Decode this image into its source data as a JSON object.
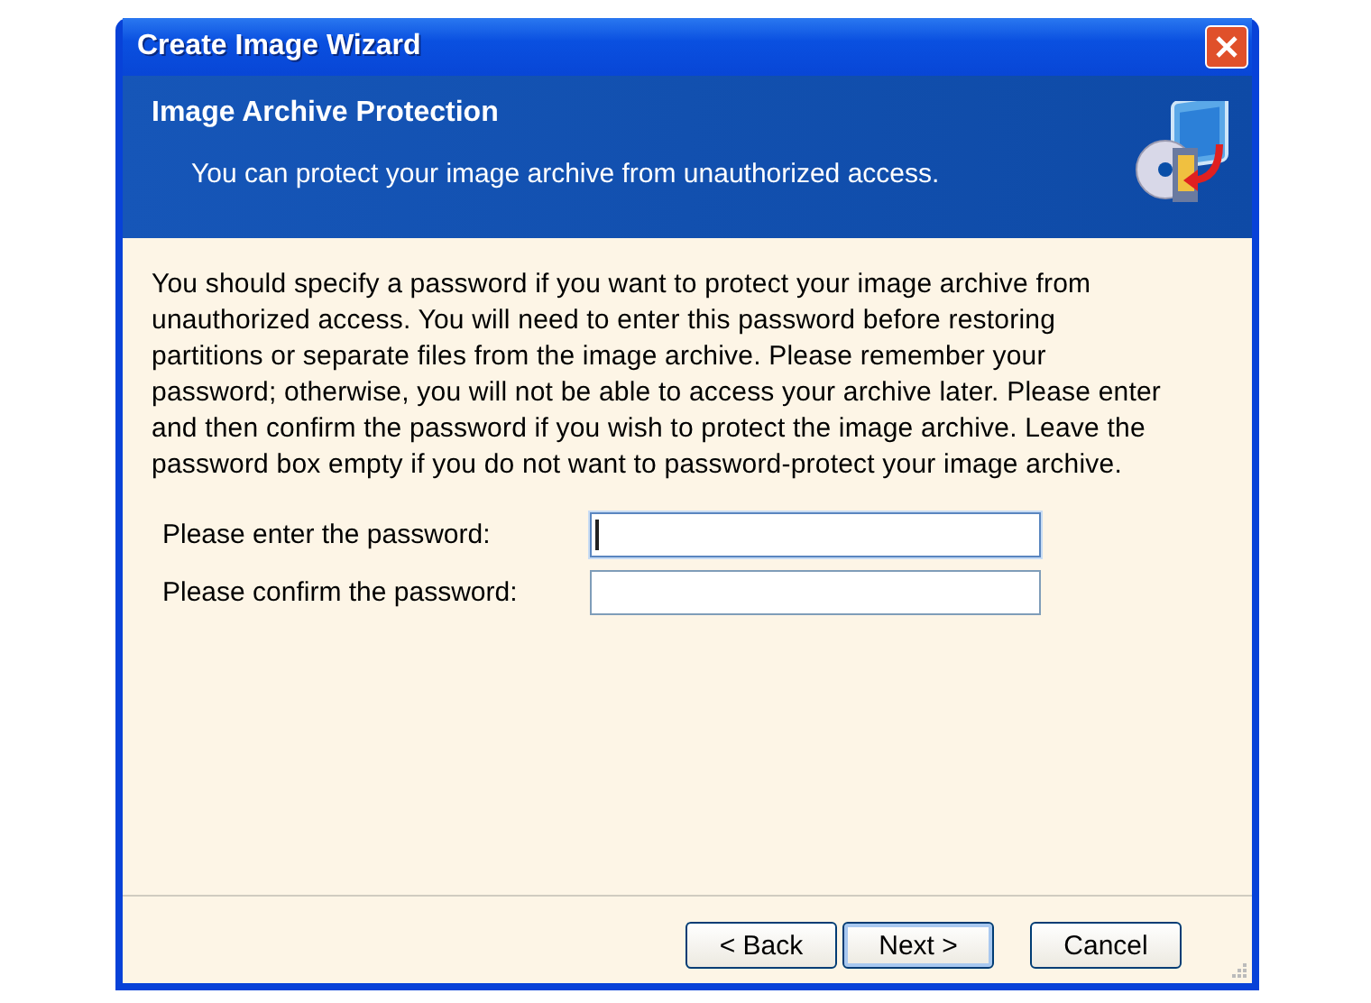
{
  "window": {
    "title": "Create Image Wizard"
  },
  "header": {
    "title": "Image Archive Protection",
    "subtitle": "You can protect your image archive from unauthorized access."
  },
  "description": "You should specify a password if you want to protect your image archive from unauthorized access. You will need to enter this password before restoring partitions or separate files from the image archive. Please remember your password; otherwise, you will not be able to access your archive later. Please enter and then confirm the password if you wish to protect the image archive. Leave the password box empty if you do not want to password-protect your image archive.",
  "fields": [
    {
      "label": "Please enter the password:",
      "focused": true
    },
    {
      "label": "Please confirm the password:",
      "focused": false
    }
  ],
  "buttons": [
    {
      "label": "< Back",
      "kind": "nav"
    },
    {
      "label": "Next >",
      "kind": "default"
    },
    {
      "label": "Cancel",
      "kind": "cancel"
    }
  ]
}
